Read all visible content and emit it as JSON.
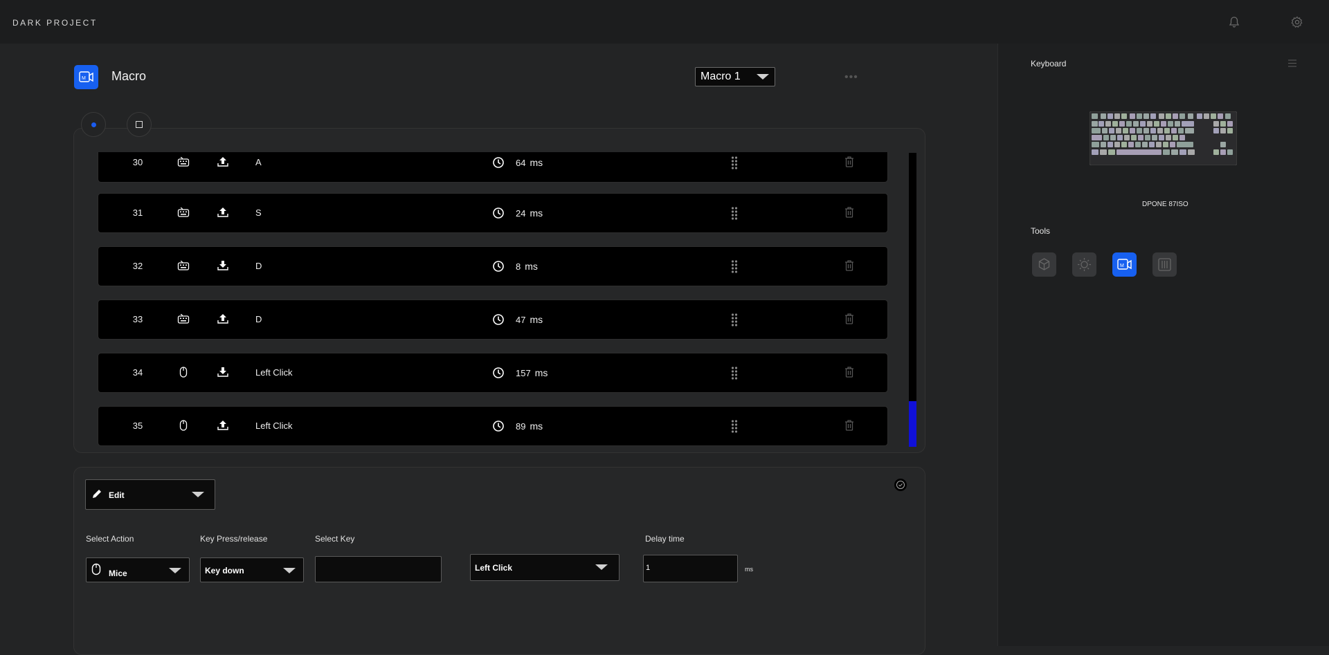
{
  "app": {
    "brand": "DARK PROJECT"
  },
  "header": {
    "title": "Macro",
    "macro_select": "Macro 1",
    "more_label": "•••"
  },
  "rows": [
    {
      "index": "30",
      "device": "keyboard-icon",
      "action": "key-up-icon",
      "key": "A",
      "delay": "64",
      "unit": "ms"
    },
    {
      "index": "31",
      "device": "keyboard-icon",
      "action": "key-up-icon",
      "key": "S",
      "delay": "24",
      "unit": "ms"
    },
    {
      "index": "32",
      "device": "keyboard-icon",
      "action": "key-down-icon",
      "key": "D",
      "delay": "8",
      "unit": "ms"
    },
    {
      "index": "33",
      "device": "keyboard-icon",
      "action": "key-up-icon",
      "key": "D",
      "delay": "47",
      "unit": "ms"
    },
    {
      "index": "34",
      "device": "mouse-icon",
      "action": "key-down-icon",
      "key": "Left Click",
      "delay": "157",
      "unit": "ms"
    },
    {
      "index": "35",
      "device": "mouse-icon",
      "action": "key-up-icon",
      "key": "Left Click",
      "delay": "89",
      "unit": "ms"
    }
  ],
  "scroll": {
    "position": 1.0
  },
  "editor": {
    "mode": "Edit",
    "labels": {
      "action": "Select Action",
      "press": "Key Press/release",
      "key": "Select Key",
      "delay": "Delay time"
    },
    "action_value": "Mice",
    "press_value": "Key down",
    "key_value": "",
    "mouse_button": "Left Click",
    "delay_value": "1",
    "delay_unit": "ms"
  },
  "sidebar": {
    "keyboard_title": "Keyboard",
    "device_name": "DPONE 87ISO",
    "tools_title": "Tools",
    "tools": [
      "cube-icon",
      "sun-icon",
      "macro-icon",
      "sliders-icon"
    ],
    "active_tool": "macro-icon"
  },
  "colors": {
    "accent": "#1760f0",
    "scrollbar": "#1010d8",
    "background": "#232425"
  }
}
